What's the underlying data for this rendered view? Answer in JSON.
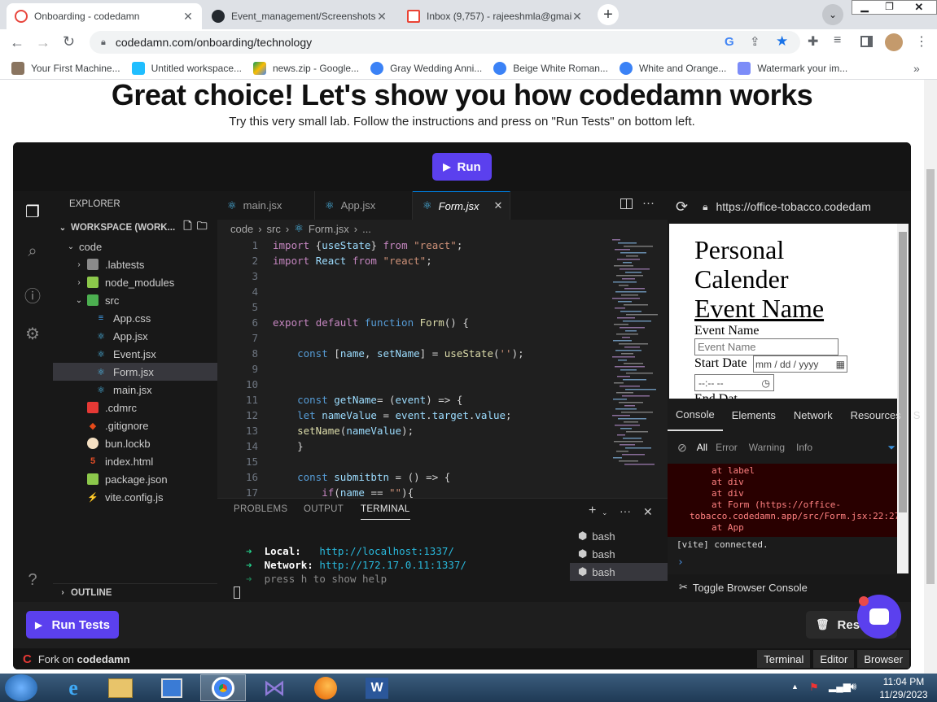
{
  "browser": {
    "tabs": [
      {
        "title": "Onboarding - codedamn",
        "active": true,
        "icon": "codedamn-c-icon"
      },
      {
        "title": "Event_management/Screenshots",
        "active": false,
        "icon": "github-icon"
      },
      {
        "title": "Inbox (9,757) - rajeeshmla@gmail",
        "active": false,
        "icon": "gmail-icon"
      }
    ],
    "url": "codedamn.com/onboarding/technology",
    "bookmarks": [
      {
        "label": "Your First Machine...",
        "icon": "person-icon"
      },
      {
        "label": "Untitled workspace...",
        "icon": "kaggle-icon"
      },
      {
        "label": "news.zip - Google...",
        "icon": "google-drive-icon"
      },
      {
        "label": "Gray Wedding Anni...",
        "icon": "canva-icon"
      },
      {
        "label": "Beige White Roman...",
        "icon": "canva-icon"
      },
      {
        "label": "White and Orange...",
        "icon": "canva-icon"
      },
      {
        "label": "Watermark your im...",
        "icon": "heart-icon"
      }
    ],
    "more_bookmarks": "»"
  },
  "page": {
    "heading": "Great choice! Let's show you how codedamn works",
    "subheading": "Try this very small lab. Follow the instructions and press on \"Run Tests\" on bottom left.",
    "run_label": "Run",
    "run_tests_label": "Run Tests",
    "reset_label": "Reset Lab",
    "fork_prefix": "Fork on",
    "fork_brand": "codedamn",
    "footer_buttons": [
      "Terminal",
      "Editor",
      "Browser"
    ]
  },
  "explorer": {
    "title": "EXPLORER",
    "workspace": "WORKSPACE (WORK...",
    "outline": "OUTLINE",
    "tree": [
      {
        "label": "code",
        "kind": "folder-open",
        "depth": 1
      },
      {
        "label": ".labtests",
        "kind": "folder",
        "depth": 2
      },
      {
        "label": "node_modules",
        "kind": "folder-node",
        "depth": 2
      },
      {
        "label": "src",
        "kind": "folder-src-open",
        "depth": 2
      },
      {
        "label": "App.css",
        "kind": "css",
        "depth": 3
      },
      {
        "label": "App.jsx",
        "kind": "react",
        "depth": 3
      },
      {
        "label": "Event.jsx",
        "kind": "react",
        "depth": 3
      },
      {
        "label": "Form.jsx",
        "kind": "react",
        "depth": 3,
        "selected": true
      },
      {
        "label": "main.jsx",
        "kind": "react",
        "depth": 3
      },
      {
        "label": ".cdmrc",
        "kind": "cdmrc",
        "depth": 2
      },
      {
        "label": ".gitignore",
        "kind": "git",
        "depth": 2
      },
      {
        "label": "bun.lockb",
        "kind": "bun",
        "depth": 2
      },
      {
        "label": "index.html",
        "kind": "html",
        "depth": 2
      },
      {
        "label": "package.json",
        "kind": "json",
        "depth": 2
      },
      {
        "label": "vite.config.js",
        "kind": "vite",
        "depth": 2
      }
    ]
  },
  "editor": {
    "tabs": [
      {
        "label": "main.jsx",
        "active": false
      },
      {
        "label": "App.jsx",
        "active": false
      },
      {
        "label": "Form.jsx",
        "active": true
      }
    ],
    "breadcrumb": [
      "code",
      "src",
      "Form.jsx",
      "..."
    ],
    "lines": [
      {
        "n": "1",
        "t": "import {useState} from \"react\";"
      },
      {
        "n": "2",
        "t": "import React from \"react\";"
      },
      {
        "n": "3",
        "t": ""
      },
      {
        "n": "4",
        "t": ""
      },
      {
        "n": "5",
        "t": ""
      },
      {
        "n": "6",
        "t": "export default function Form() {"
      },
      {
        "n": "7",
        "t": ""
      },
      {
        "n": "8",
        "t": "    const [name, setName] = useState('');"
      },
      {
        "n": "9",
        "t": ""
      },
      {
        "n": "10",
        "t": ""
      },
      {
        "n": "11",
        "t": "    const getName= (event) => {"
      },
      {
        "n": "12",
        "t": "    let nameValue = event.target.value;"
      },
      {
        "n": "13",
        "t": "    setName(nameValue);"
      },
      {
        "n": "14",
        "t": "    }"
      },
      {
        "n": "15",
        "t": ""
      },
      {
        "n": "16",
        "t": "    const submitbtn = () => {"
      },
      {
        "n": "17",
        "t": "        if(name == \"\"){"
      }
    ]
  },
  "panel": {
    "tabs": [
      "PROBLEMS",
      "OUTPUT",
      "TERMINAL"
    ],
    "active_tab": "TERMINAL",
    "terminal_lines": [
      {
        "arrow": "➜",
        "label": "Local:",
        "value": "http://localhost:1337/"
      },
      {
        "arrow": "➜",
        "label": "Network:",
        "value": "http://172.17.0.11:1337/"
      },
      {
        "arrow": "➜",
        "label": "press h to show help",
        "value": ""
      }
    ],
    "shells": [
      "bash",
      "bash",
      "bash"
    ]
  },
  "preview": {
    "url": "https://office-tobacco.codedam",
    "title_lines": [
      "Personal",
      "Calender"
    ],
    "event_heading": "Event Name",
    "event_label": "Event Name",
    "event_placeholder": "Event Name",
    "start_label": "Start Date",
    "date_placeholder": "mm / dd / yyyy",
    "time_placeholder": "--:-- --",
    "end_label": "End Dat",
    "console_tabs": [
      "Console",
      "Elements",
      "Network",
      "Resources",
      "S"
    ],
    "filters": [
      "All",
      "Error",
      "Warning",
      "Info"
    ],
    "error_lines": [
      "at label",
      "at div",
      "at div",
      "at Form (https://office-",
      "tobacco.codedamn.app/src/Form.jsx:22:27",
      "at App"
    ],
    "log_line": "[vite] connected.",
    "toggle_label": "Toggle Browser Console"
  },
  "taskbar": {
    "time": "11:04 PM",
    "date": "11/29/2023"
  }
}
